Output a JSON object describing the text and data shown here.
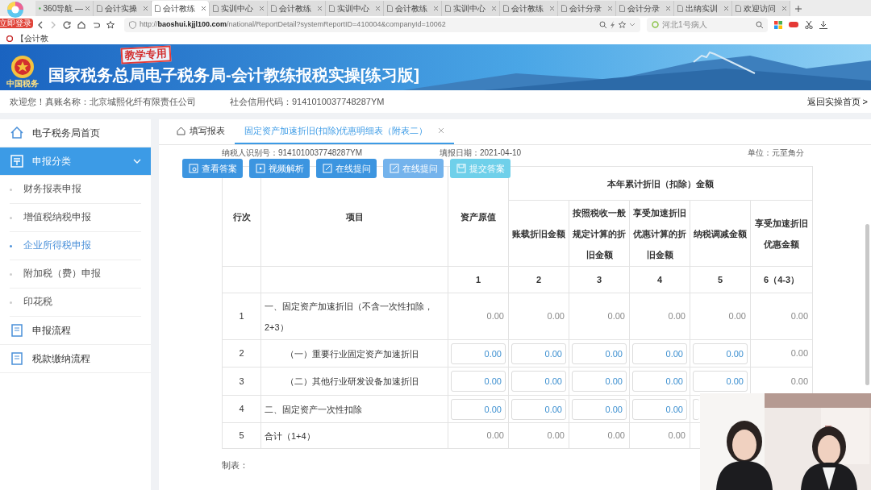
{
  "browser": {
    "login_badge": "立即登录",
    "tabs": [
      {
        "label": "360导航 —",
        "selected": false
      },
      {
        "label": "会计实操",
        "selected": false
      },
      {
        "label": "会计教练",
        "selected": true
      },
      {
        "label": "实训中心",
        "selected": false
      },
      {
        "label": "会计教练",
        "selected": false
      },
      {
        "label": "实训中心",
        "selected": false
      },
      {
        "label": "会计教练",
        "selected": false
      },
      {
        "label": "实训中心",
        "selected": false
      },
      {
        "label": "会计教练",
        "selected": false
      },
      {
        "label": "会计分录",
        "selected": false
      },
      {
        "label": "会计分录",
        "selected": false
      },
      {
        "label": "出纳实训",
        "selected": false
      },
      {
        "label": "欢迎访问",
        "selected": false
      }
    ],
    "url_host": "baoshui.kjjl100.com",
    "url_prefix": "http://",
    "url_path": "/national/ReportDetail?systemReportID=410004&companyId=10062",
    "search_placeholder": "河北1号病人",
    "bookmark": "【会计教"
  },
  "banner": {
    "title": "国家税务总局电子税务局-会计教练报税实操[练习版]",
    "stamp": "教学专用",
    "emblem_caption": "中国税务"
  },
  "info_bar": {
    "account": "欢迎您！真账名称：北京城熙化纤有限责任公司",
    "credit_code": "社会信用代码：9141010037748287YM",
    "back_link": "返回实操首页 >"
  },
  "sidebar": {
    "items": [
      {
        "label": "电子税务局首页",
        "kind": "home",
        "selected": false
      },
      {
        "label": "申报分类",
        "kind": "group",
        "selected": true,
        "expanded": true,
        "children": [
          {
            "label": "财务报表申报",
            "selected": false
          },
          {
            "label": "增值税纳税申报",
            "selected": false
          },
          {
            "label": "企业所得税申报",
            "selected": true
          },
          {
            "label": "附加税（费）申报",
            "selected": false
          },
          {
            "label": "印花税",
            "selected": false
          }
        ]
      },
      {
        "label": "申报流程",
        "kind": "doc",
        "selected": false
      },
      {
        "label": "税款缴纳流程",
        "kind": "doc",
        "selected": false
      }
    ]
  },
  "page_tabs": [
    {
      "label": "填写报表",
      "kind": "home",
      "selected": false
    },
    {
      "label": "固定资产加速折旧(扣除)优惠明细表（附表二）",
      "kind": "closable",
      "selected": true
    }
  ],
  "report": {
    "taxpayer_id": "纳税人识别号：9141010037748287YM",
    "fill_date": "填报日期：2021-04-10",
    "unit": "单位：元至角分",
    "actions": [
      {
        "label": "查看答案",
        "kind": "answer",
        "disabled": false
      },
      {
        "label": "视频解析",
        "kind": "video",
        "disabled": false
      },
      {
        "label": "在线提问",
        "kind": "ask",
        "disabled": false
      },
      {
        "label": "在线提问",
        "kind": "ask",
        "disabled": true
      },
      {
        "label": "提交答案",
        "kind": "submit",
        "disabled": true
      }
    ],
    "header": {
      "row_no": "行次",
      "item": "项目",
      "original_value": "资产原值",
      "group": "本年累计折旧（扣除）金额",
      "columns": [
        "账载折旧金额",
        "按照税收一般规定计算的折旧金额",
        "享受加速折旧优惠计算的折旧金额",
        "纳税调减金额",
        "享受加速折旧优惠金额"
      ],
      "numbers": [
        "1",
        "2",
        "3",
        "4",
        "5",
        "6（4-3）"
      ]
    },
    "rows": [
      {
        "no": "1",
        "item": "一、固定资产加速折旧（不含一次性扣除，2+3）",
        "indent": false,
        "cells": [
          {
            "value": "0.00",
            "kind": "text"
          },
          {
            "value": "0.00",
            "kind": "text"
          },
          {
            "value": "0.00",
            "kind": "text"
          },
          {
            "value": "0.00",
            "kind": "text"
          },
          {
            "value": "0.00",
            "kind": "text"
          },
          {
            "value": "0.00",
            "kind": "text"
          }
        ]
      },
      {
        "no": "2",
        "item": "（一）重要行业固定资产加速折旧",
        "indent": true,
        "cells": [
          {
            "value": "0.00",
            "kind": "input"
          },
          {
            "value": "0.00",
            "kind": "input"
          },
          {
            "value": "0.00",
            "kind": "input"
          },
          {
            "value": "0.00",
            "kind": "input"
          },
          {
            "value": "0.00",
            "kind": "input"
          },
          {
            "value": "0.00",
            "kind": "text"
          }
        ]
      },
      {
        "no": "3",
        "item": "（二）其他行业研发设备加速折旧",
        "indent": true,
        "cells": [
          {
            "value": "0.00",
            "kind": "input"
          },
          {
            "value": "0.00",
            "kind": "input"
          },
          {
            "value": "0.00",
            "kind": "input"
          },
          {
            "value": "0.00",
            "kind": "input"
          },
          {
            "value": "0.00",
            "kind": "input"
          },
          {
            "value": "0.00",
            "kind": "text"
          }
        ]
      },
      {
        "no": "4",
        "item": "二、固定资产一次性扣除",
        "indent": false,
        "cells": [
          {
            "value": "0.00",
            "kind": "input"
          },
          {
            "value": "0.00",
            "kind": "input"
          },
          {
            "value": "0.00",
            "kind": "input"
          },
          {
            "value": "0.00",
            "kind": "input"
          }
        ]
      },
      {
        "no": "5",
        "item": "合计（1+4）",
        "indent": false,
        "cells": [
          {
            "value": "0.00",
            "kind": "text"
          },
          {
            "value": "0.00",
            "kind": "text"
          },
          {
            "value": "0.00",
            "kind": "text"
          },
          {
            "value": "0.00",
            "kind": "text"
          }
        ]
      }
    ],
    "footer": "制表："
  }
}
